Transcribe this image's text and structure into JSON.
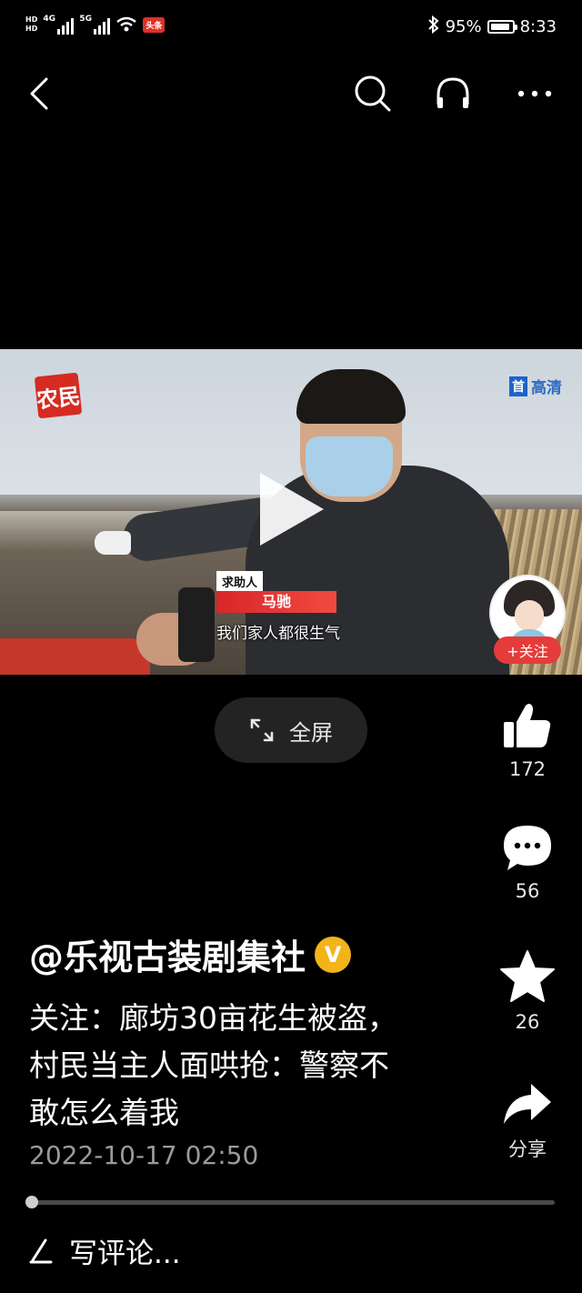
{
  "status_bar": {
    "hd1": "HD",
    "hd2": "HD",
    "net1": "4G",
    "net2": "5G",
    "app_badge": "头条",
    "battery_percent": "95%",
    "battery_level": 0.95,
    "time": "8:33"
  },
  "nav": {
    "icons": [
      "back-icon",
      "search-icon",
      "headphones-icon",
      "more-icon"
    ]
  },
  "video": {
    "logo_left": "农民",
    "logo_right_block": "首",
    "logo_right_text": "高清",
    "caption_tag": "求助人",
    "caption_name": "马驰",
    "caption_subtitle": "我们家人都很生气",
    "follow_label": "+关注"
  },
  "fullscreen": {
    "label": "全屏"
  },
  "actions": {
    "like_count": "172",
    "comment_count": "56",
    "favorite_count": "26",
    "share_label": "分享"
  },
  "post": {
    "author": "@乐视古装剧集社",
    "verified_badge": "V",
    "title": "关注：廊坊30亩花生被盗，村民当主人面哄抢：警察不敢怎么着我",
    "date": "2022-10-17 02:50",
    "progress": 0.0
  },
  "comment": {
    "placeholder": "写评论..."
  }
}
